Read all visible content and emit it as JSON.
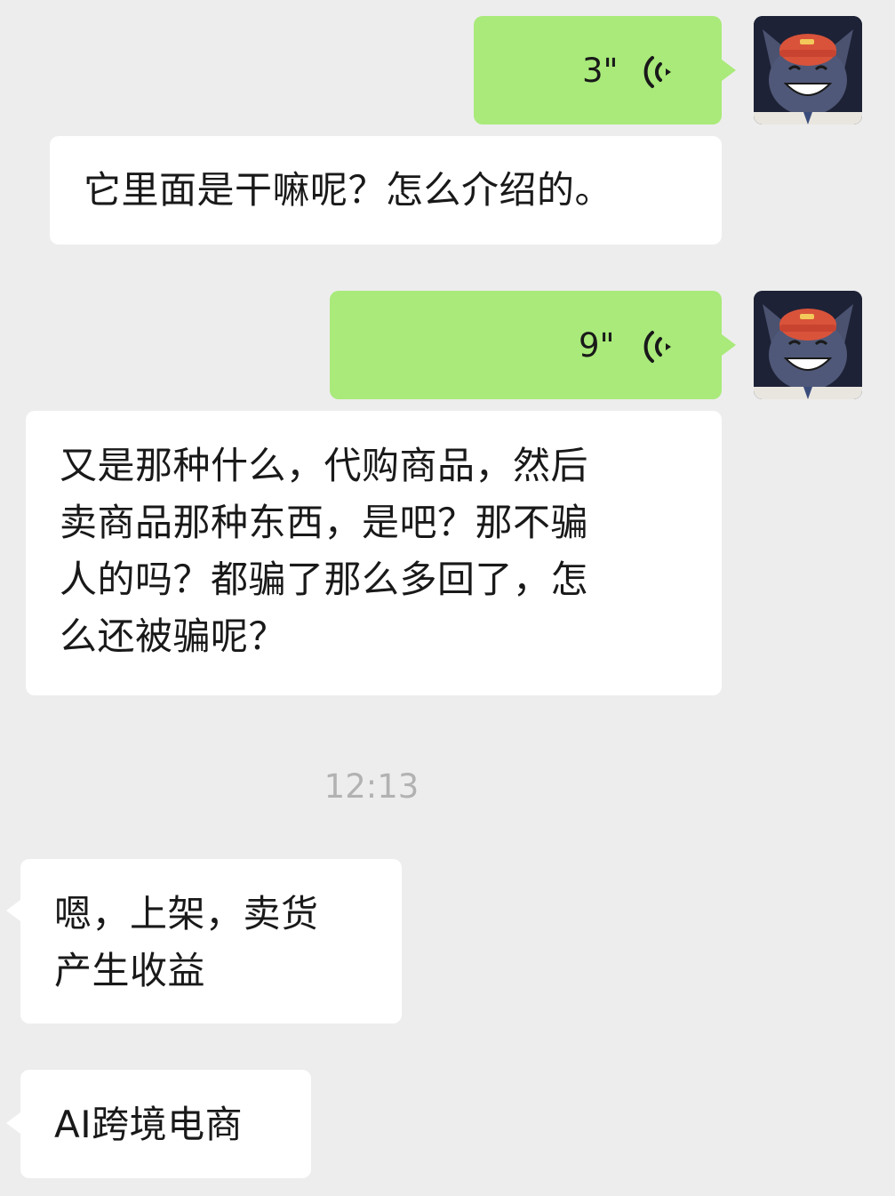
{
  "messages": [
    {
      "type": "voice",
      "from": "me",
      "duration": "3\""
    },
    {
      "type": "text",
      "from": "other",
      "text": "它里面是干嘛呢？怎么介绍的。"
    },
    {
      "type": "voice",
      "from": "me",
      "duration": "9\""
    },
    {
      "type": "text",
      "from": "other",
      "text": "又是那种什么，代购商品，然后\n卖商品那种东西，是吧？那不骗\n人的吗？都骗了那么多回了，怎\n么还被骗呢？"
    },
    {
      "type": "text",
      "from": "other",
      "text": "嗯，上架，卖货\n产生收益"
    },
    {
      "type": "text",
      "from": "other",
      "text": "AI跨境电商"
    }
  ],
  "timestamp": "12:13",
  "colors": {
    "background": "#ededed",
    "sent_bubble": "#a9ea7a",
    "received_bubble": "#ffffff",
    "timestamp_text": "#b2b2b2"
  },
  "icons": {
    "voice": "voice-wave-icon",
    "avatar": "cartoon-wolf-avatar"
  }
}
